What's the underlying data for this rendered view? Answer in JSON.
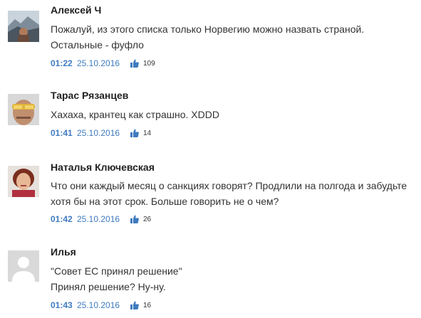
{
  "comments": [
    {
      "author": "Алексей Ч",
      "avatar_icon": "user-photo-mountain",
      "lines": [
        "Пожалуй, из этого списка только Норвегию можно назвать страной.",
        "Остальные - фуфло"
      ],
      "time": "01:22",
      "date": "25.10.2016",
      "likes": "109"
    },
    {
      "author": "Тарас Рязанцев",
      "avatar_icon": "user-photo-sunglasses",
      "lines": [
        "Хахаха, крантец как страшно. XDDD"
      ],
      "time": "01:41",
      "date": "25.10.2016",
      "likes": "14"
    },
    {
      "author": "Наталья Ключевская",
      "avatar_icon": "user-photo-woman",
      "lines": [
        "Что они каждый месяц о санкциях говорят? Продлили на полгода и забудьте",
        "хотя бы на этот срок. Больше говорить не о чем?"
      ],
      "time": "01:42",
      "date": "25.10.2016",
      "likes": "26"
    },
    {
      "author": "Илья",
      "avatar_icon": "default-user-silhouette",
      "lines": [
        "\"Совет ЕС принял решение\"",
        "Принял решение? Ну-ну."
      ],
      "time": "01:43",
      "date": "25.10.2016",
      "likes": "16"
    }
  ],
  "colors": {
    "accent": "#3f7bbf",
    "text": "#333333",
    "author": "#222222"
  }
}
